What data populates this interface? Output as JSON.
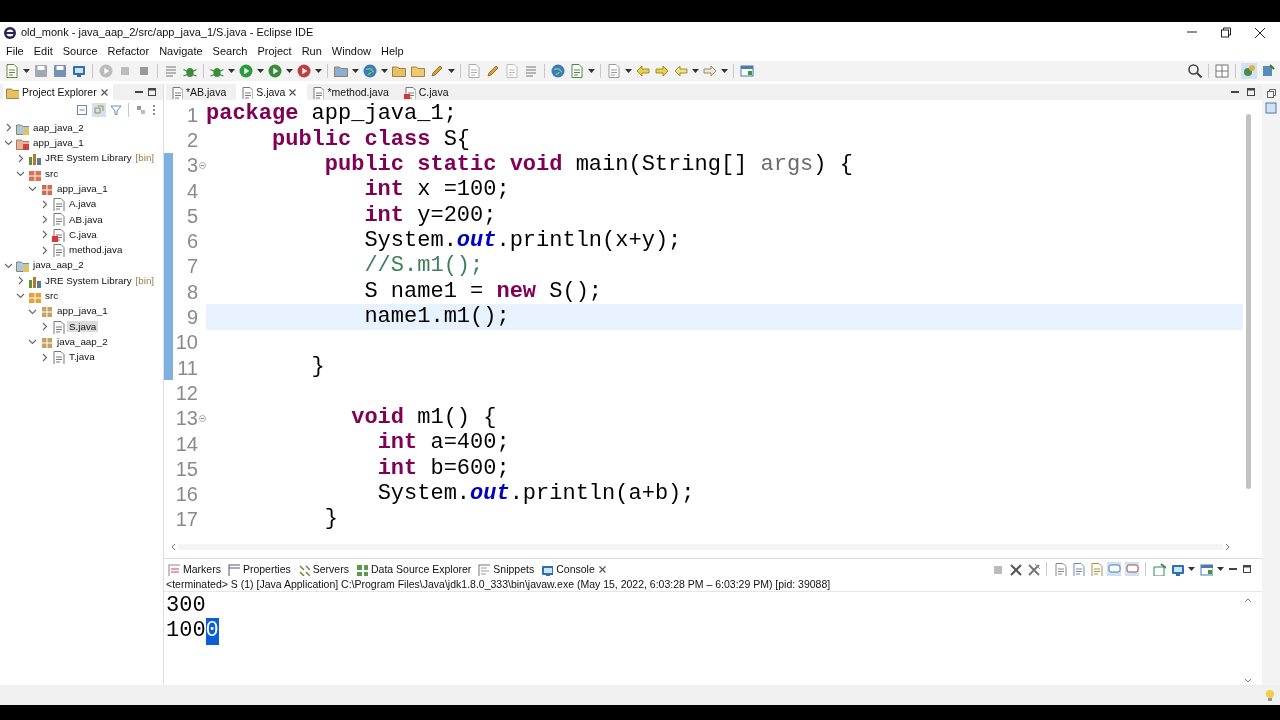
{
  "window": {
    "title": "old_monk - java_aap_2/src/app_java_1/S.java - Eclipse IDE"
  },
  "menu": [
    "File",
    "Edit",
    "Source",
    "Refactor",
    "Navigate",
    "Search",
    "Project",
    "Run",
    "Window",
    "Help"
  ],
  "project_explorer": {
    "title": "Project Explorer",
    "tree": [
      {
        "label": "aap_java_2",
        "kind": "project",
        "expanded": false,
        "selected": false,
        "error": false
      },
      {
        "label": "app_java_1",
        "kind": "project",
        "expanded": true,
        "selected": false,
        "error": true,
        "children": [
          {
            "label": "JRE System Library",
            "decoration": "[bin]",
            "kind": "library",
            "expanded": false,
            "selected": false,
            "error": false
          },
          {
            "label": "src",
            "kind": "source",
            "expanded": true,
            "selected": false,
            "error": true,
            "children": [
              {
                "label": "app_java_1",
                "kind": "package",
                "expanded": true,
                "selected": false,
                "error": true,
                "children": [
                  {
                    "label": "A.java",
                    "kind": "file",
                    "expanded": false,
                    "selected": false,
                    "error": false
                  },
                  {
                    "label": "AB.java",
                    "kind": "file",
                    "expanded": false,
                    "selected": false,
                    "error": false
                  },
                  {
                    "label": "C.java",
                    "kind": "file",
                    "expanded": false,
                    "selected": false,
                    "error": true
                  },
                  {
                    "label": "method.java",
                    "kind": "file",
                    "expanded": false,
                    "selected": false,
                    "error": false
                  }
                ]
              }
            ]
          }
        ]
      },
      {
        "label": "java_aap_2",
        "kind": "project",
        "expanded": true,
        "selected": false,
        "error": false,
        "children": [
          {
            "label": "JRE System Library",
            "decoration": "[bin]",
            "kind": "library",
            "expanded": false,
            "selected": false,
            "error": false
          },
          {
            "label": "src",
            "kind": "source",
            "expanded": true,
            "selected": false,
            "error": false,
            "children": [
              {
                "label": "app_java_1",
                "kind": "package",
                "expanded": true,
                "selected": false,
                "error": false,
                "children": [
                  {
                    "label": "S.java",
                    "kind": "file",
                    "expanded": false,
                    "selected": true,
                    "error": false
                  }
                ]
              },
              {
                "label": "java_aap_2",
                "kind": "package",
                "expanded": true,
                "selected": false,
                "error": false,
                "children": [
                  {
                    "label": "T.java",
                    "kind": "file",
                    "expanded": false,
                    "selected": false,
                    "error": false
                  }
                ]
              }
            ]
          }
        ]
      }
    ]
  },
  "editor": {
    "tabs": [
      {
        "label": "*AB.java",
        "selected": false,
        "error": false
      },
      {
        "label": "S.java",
        "selected": true,
        "error": false
      },
      {
        "label": "*method.java",
        "selected": false,
        "error": false
      },
      {
        "label": "C.java",
        "selected": false,
        "error": true
      }
    ],
    "lines": [
      {
        "number": "1",
        "fold": false,
        "range": false,
        "current": false,
        "tokens": [
          {
            "kind": "keyword",
            "text": "package"
          },
          {
            "kind": "plain",
            "text": " app_java_1;"
          }
        ]
      },
      {
        "number": "2",
        "fold": false,
        "range": false,
        "current": false,
        "tokens": [
          {
            "kind": "keyword",
            "text": "     public class"
          },
          {
            "kind": "plain",
            "text": " S{"
          }
        ]
      },
      {
        "number": "3",
        "fold": true,
        "range": true,
        "current": false,
        "tokens": [
          {
            "kind": "keyword",
            "text": "         public static void"
          },
          {
            "kind": "plain",
            "text": " main(String[] "
          },
          {
            "kind": "param",
            "text": "args"
          },
          {
            "kind": "plain",
            "text": ") {"
          }
        ]
      },
      {
        "number": "4",
        "fold": false,
        "range": true,
        "current": false,
        "tokens": [
          {
            "kind": "keyword",
            "text": "            int"
          },
          {
            "kind": "plain",
            "text": " x =100;"
          }
        ]
      },
      {
        "number": "5",
        "fold": false,
        "range": true,
        "current": false,
        "tokens": [
          {
            "kind": "keyword",
            "text": "            int"
          },
          {
            "kind": "plain",
            "text": " y=200;"
          }
        ]
      },
      {
        "number": "6",
        "fold": false,
        "range": true,
        "current": false,
        "tokens": [
          {
            "kind": "plain",
            "text": "            System."
          },
          {
            "kind": "field",
            "text": "out"
          },
          {
            "kind": "plain",
            "text": ".println(x+y);"
          }
        ]
      },
      {
        "number": "7",
        "fold": false,
        "range": true,
        "current": false,
        "tokens": [
          {
            "kind": "comment",
            "text": "            //S.m1();"
          }
        ]
      },
      {
        "number": "8",
        "fold": false,
        "range": true,
        "current": false,
        "tokens": [
          {
            "kind": "plain",
            "text": "            S name1 = "
          },
          {
            "kind": "keyword",
            "text": "new"
          },
          {
            "kind": "plain",
            "text": " S();"
          }
        ]
      },
      {
        "number": "9",
        "fold": false,
        "range": true,
        "current": true,
        "tokens": [
          {
            "kind": "plain",
            "text": "            name1.m1();"
          }
        ]
      },
      {
        "number": "10",
        "fold": false,
        "range": true,
        "current": false
      },
      {
        "number": "11",
        "fold": false,
        "range": true,
        "current": false,
        "tokens": [
          {
            "kind": "plain",
            "text": "        }"
          }
        ]
      },
      {
        "number": "12",
        "fold": false,
        "range": false,
        "current": false
      },
      {
        "number": "13",
        "fold": true,
        "range": false,
        "current": false,
        "tokens": [
          {
            "kind": "keyword",
            "text": "           void"
          },
          {
            "kind": "plain",
            "text": " m1() {"
          }
        ]
      },
      {
        "number": "14",
        "fold": false,
        "range": false,
        "current": false,
        "tokens": [
          {
            "kind": "keyword",
            "text": "             int"
          },
          {
            "kind": "plain",
            "text": " a=400;"
          }
        ]
      },
      {
        "number": "15",
        "fold": false,
        "range": false,
        "current": false,
        "tokens": [
          {
            "kind": "keyword",
            "text": "             int"
          },
          {
            "kind": "plain",
            "text": " b=600;"
          }
        ]
      },
      {
        "number": "16",
        "fold": false,
        "range": false,
        "current": false,
        "tokens": [
          {
            "kind": "plain",
            "text": "             System."
          },
          {
            "kind": "field",
            "text": "out"
          },
          {
            "kind": "plain",
            "text": ".println(a+b);"
          }
        ]
      },
      {
        "number": "17",
        "fold": false,
        "range": false,
        "current": false,
        "tokens": [
          {
            "kind": "plain",
            "text": "         }"
          }
        ]
      }
    ]
  },
  "bottom_panel": {
    "tabs": [
      {
        "label": "Markers",
        "kind": "markers",
        "selected": false
      },
      {
        "label": "Properties",
        "kind": "properties",
        "selected": false
      },
      {
        "label": "Servers",
        "kind": "servers",
        "selected": false
      },
      {
        "label": "Data Source Explorer",
        "kind": "datasource",
        "selected": false
      },
      {
        "label": "Snippets",
        "kind": "snippets",
        "selected": false
      },
      {
        "label": "Console",
        "kind": "console",
        "selected": true
      }
    ],
    "console": {
      "header": "<terminated> S (1) [Java Application] C:\\Program Files\\Java\\jdk1.8.0_333\\bin\\javaw.exe  (May 15, 2022, 6:03:28 PM – 6:03:29 PM) [pid: 39088]",
      "output": [
        {
          "segments": [
            {
              "text": "300",
              "selected": false
            }
          ]
        },
        {
          "segments": [
            {
              "text": "100",
              "selected": false
            },
            {
              "text": "0",
              "selected": true
            }
          ]
        }
      ]
    }
  }
}
